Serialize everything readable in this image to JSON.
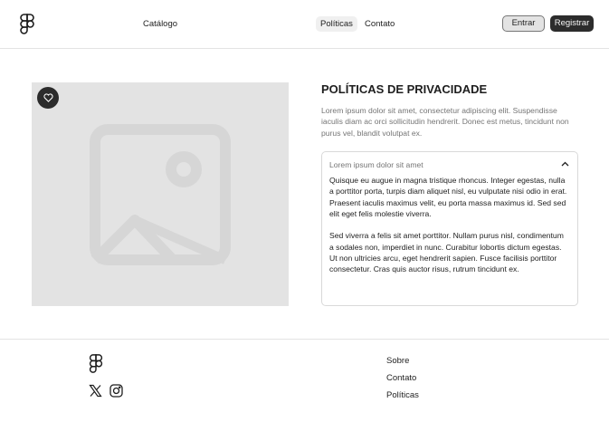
{
  "header": {
    "nav": {
      "catalogo": "Catálogo",
      "politicas": "Políticas",
      "contato": "Contato"
    },
    "buttons": {
      "entrar": "Entrar",
      "registrar": "Registrar"
    }
  },
  "main": {
    "title": "POLÍTICAS DE PRIVACIDADE",
    "description": "Lorem ipsum dolor sit amet, consectetur adipiscing elit. Suspendisse  iaculis diam ac orci sollicitudin hendrerit. Donec est metus, tincidunt  non purus vel, blandit volutpat ex.",
    "accordion": {
      "title": "Lorem ipsum dolor sit amet",
      "paragraphs": [
        "Quisque eu augue in magna tristique rhoncus. Integer egestas, nulla a  porttitor porta, turpis diam aliquet nisl, eu vulputate nisi odio in  erat. Praesent iaculis maximus velit, eu porta massa maximus id. Sed sed elit eget felis molestie viverra.",
        "Sed viverra a felis sit amet  porttitor. Nullam purus nisl, condimentum a sodales non, imperdiet in  nunc. Curabitur lobortis dictum egestas. Ut non ultricies arcu, eget  hendrerit sapien. Fusce facilisis porttitor consectetur. Cras quis  auctor risus, rutrum tincidunt ex."
      ]
    }
  },
  "footer": {
    "links": {
      "sobre": "Sobre",
      "contato": "Contato",
      "politicas": "Políticas"
    }
  },
  "icons": {
    "logo": "figma-logo-icon",
    "favorite": "heart-icon",
    "image": "image-placeholder-icon",
    "chevron": "chevron-up-icon",
    "x": "x-logo-icon",
    "instagram": "instagram-icon"
  },
  "colors": {
    "primary_dark": "#2c2c2c",
    "placeholder_bg": "#e3e3e3",
    "muted_text": "#757575"
  }
}
